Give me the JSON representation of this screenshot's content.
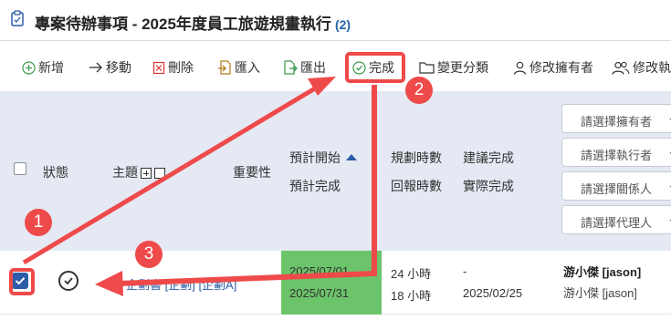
{
  "title": {
    "text": "專案待辦事項 - 2025年度員工旅遊規畫執行",
    "count": "(2)"
  },
  "toolbar": {
    "add": "新增",
    "move": "移動",
    "delete": "刪除",
    "import": "匯入",
    "export": "匯出",
    "complete": "完成",
    "change_category": "變更分類",
    "change_owner": "修改擁有者",
    "change_executor": "修改執"
  },
  "columns": {
    "status": "狀態",
    "subject": "主題",
    "importance": "重要性",
    "plan_start": "預計開始",
    "plan_complete": "預計完成",
    "plan_hours": "規劃時數",
    "report_hours": "回報時數",
    "suggest_complete": "建議完成",
    "actual_complete": "實際完成"
  },
  "filters": {
    "owner": "請選擇擁有者",
    "executor": "請選擇執行者",
    "related": "請選擇關係人",
    "agent": "請選擇代理人"
  },
  "row": {
    "subject": "企劃書 [企劃] [企劃A]",
    "plan_start": "2025/07/01",
    "plan_complete": "2025/07/31",
    "plan_hours": "24 小時",
    "report_hours": "18 小時",
    "suggest_complete": "-",
    "actual_complete": "2025/02/25",
    "owner_main": "游小傑 [jason]",
    "owner_sub": "游小傑 [jason]"
  },
  "annotations": {
    "step1": "1",
    "step2": "2",
    "step3": "3"
  },
  "colors": {
    "accent": "#2b5ca8",
    "annotation": "#ef4a4a",
    "date_highlight": "#6cc46a",
    "header_bg": "#e4e9f3"
  }
}
